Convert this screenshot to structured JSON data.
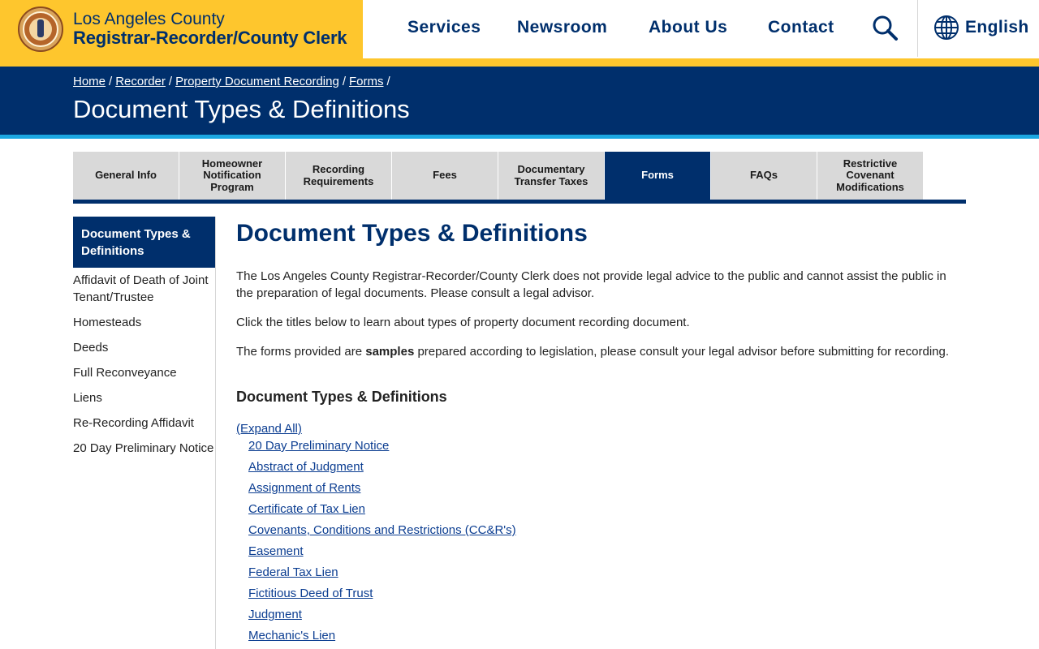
{
  "header": {
    "brand_line1": "Los Angeles County",
    "brand_line2": "Registrar-Recorder/County Clerk",
    "nav": [
      "Services",
      "Newsroom",
      "About Us",
      "Contact"
    ],
    "language": "English"
  },
  "breadcrumb": [
    "Home",
    "Recorder",
    "Property Document Recording",
    "Forms"
  ],
  "banner_title": "Document Types & Definitions",
  "tabs": [
    "General Info",
    "Homeowner Notification Program",
    "Recording Requirements",
    "Fees",
    "Documentary Transfer Taxes",
    "Forms",
    "FAQs",
    "Restrictive Covenant Modifications"
  ],
  "sidebar": {
    "active": "Document Types & Definitions",
    "items": [
      "Affidavit of Death of Joint Tenant/Trustee",
      "Homesteads",
      "Deeds",
      "Full Reconveyance",
      "Liens",
      "Re-Recording Affidavit",
      "20 Day Preliminary Notice"
    ]
  },
  "main": {
    "title": "Document Types & Definitions",
    "para1": "The Los Angeles County Registrar-Recorder/County Clerk does not provide legal advice to the public and cannot assist the public in the preparation of legal documents. Please consult a legal advisor.",
    "para2": "Click the titles below to learn about types of property document recording document.",
    "para3_before": "The forms provided are ",
    "para3_bold": "samples",
    "para3_after": " prepared according to legislation, please consult your legal advisor before submitting for recording.",
    "subheading": "Document Types & Definitions",
    "expand_all": "(Expand All)",
    "doc_links": [
      "20 Day Preliminary Notice",
      "Abstract of Judgment",
      "Assignment of Rents",
      "Certificate of Tax Lien",
      "Covenants, Conditions and Restrictions (CC&R's)",
      "Easement",
      "Federal Tax Lien",
      "Fictitious Deed of Trust",
      "Judgment",
      "Mechanic's Lien"
    ]
  },
  "colors": {
    "brand_gold": "#fec62d",
    "brand_navy": "#002f6c",
    "accent_blue": "#1ba7e1",
    "tab_gray": "#d9d9d9",
    "link_blue": "#0b3d91"
  }
}
